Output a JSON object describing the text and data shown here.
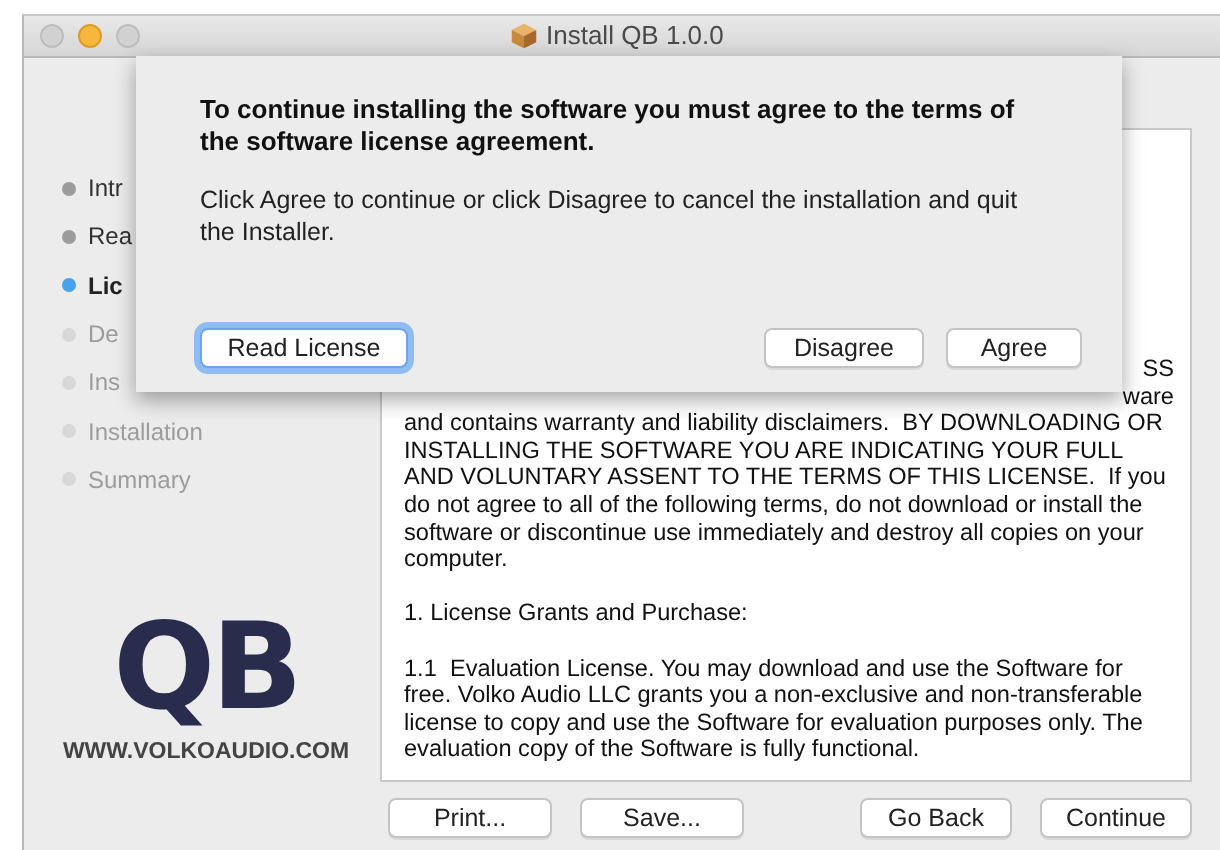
{
  "window": {
    "title": "Install QB 1.0.0"
  },
  "sidebar": {
    "steps": [
      {
        "label": "Intr",
        "done": true,
        "selected": false
      },
      {
        "label": "Rea",
        "done": true,
        "selected": false
      },
      {
        "label": "Lic",
        "done": false,
        "selected": true
      },
      {
        "label": "De",
        "done": false,
        "selected": false
      },
      {
        "label": "Ins",
        "done": false,
        "selected": false
      },
      {
        "label": "Installation",
        "done": false,
        "selected": false
      },
      {
        "label": "Summary",
        "done": false,
        "selected": false
      }
    ],
    "logo": {
      "text": "QB",
      "url": "WWW.VOLKOAUDIO.COM"
    }
  },
  "license": {
    "fragments": [
      "SS",
      "ware"
    ],
    "paragraphs": [
      [
        "and contains warranty and liability disclaimers.  BY DOWNLOADING OR",
        "INSTALLING THE SOFTWARE YOU ARE INDICATING YOUR FULL",
        "AND VOLUNTARY ASSENT TO THE TERMS OF THIS LICENSE.  If you",
        "do not agree to all of the following terms, do not download or install the",
        "software or discontinue use immediately and destroy all copies on your",
        "computer."
      ],
      [
        "1. License Grants and Purchase:"
      ],
      [
        "1.1  Evaluation License. You may download and use the Software for",
        "free. Volko Audio LLC grants you a non-exclusive and non-transferable",
        "license to copy and use the Software for evaluation purposes only. The",
        "evaluation copy of the Software is fully functional."
      ]
    ]
  },
  "buttons": {
    "left": [
      "Print...",
      "Save..."
    ],
    "right": [
      "Go Back",
      "Continue"
    ]
  },
  "sheet": {
    "heading": "To continue installing the software you must agree to the terms of the software license agreement.",
    "message": "Click Agree to continue or click Disagree to cancel the installation and quit the Installer.",
    "read_button": {
      "label": "Read License",
      "focused": true
    },
    "buttons": [
      "Disagree",
      "Agree"
    ]
  }
}
